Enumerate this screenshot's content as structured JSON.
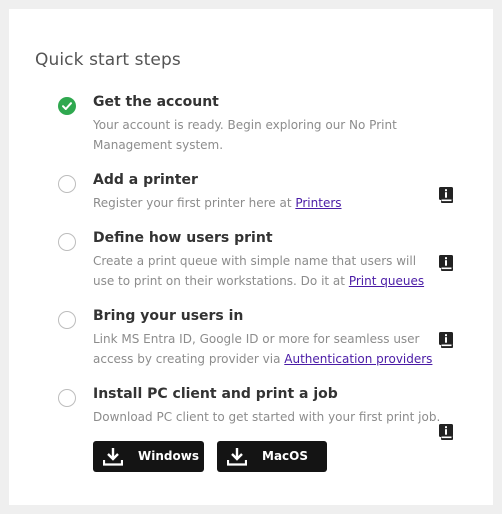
{
  "card": {
    "title": "Quick start steps"
  },
  "steps": [
    {
      "title": "Get the account",
      "desc": "Your account is ready. Begin exploring our No Print Management system.",
      "done": true
    },
    {
      "title": "Add a printer",
      "desc": "Register your first printer here at ",
      "link": "Printers",
      "done": false
    },
    {
      "title": "Define how users print",
      "desc": "Create a print queue with simple name that users will use to print on their workstations. Do it at ",
      "link": "Print queues",
      "done": false
    },
    {
      "title": "Bring your users in",
      "desc": "Link MS Entra ID, Google ID or more for seamless user access by creating provider via ",
      "link": "Authentication providers",
      "done": false
    },
    {
      "title": "Install PC client and print a job",
      "desc": "Download PC client to get started with your first print job.",
      "done": false
    }
  ],
  "downloads": {
    "windows": "Windows",
    "macos": "MacOS"
  },
  "icons": {
    "done": "check-circle-icon",
    "todo": "empty-circle-icon",
    "info": "book-info-icon",
    "download": "download-icon"
  },
  "colors": {
    "done_green": "#2fa84f",
    "link": "#4a1ba6",
    "button_bg": "#141414"
  }
}
